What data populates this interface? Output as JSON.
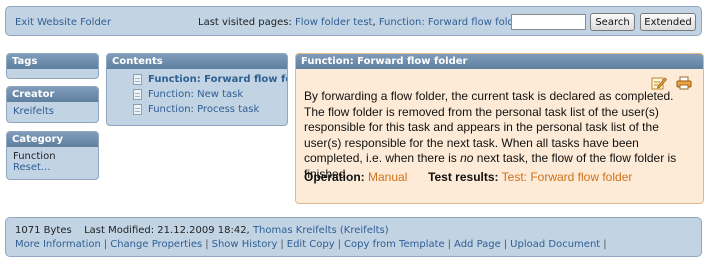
{
  "topbar": {
    "exit_link": "Exit Website Folder",
    "visited_label": "Last visited pages:",
    "visited_pages": [
      "Flow folder test",
      "Function: Forward flow folder"
    ],
    "search_placeholder": "",
    "search_button": "Search",
    "extended_button": "Extended"
  },
  "sidebar": {
    "tags_title": "Tags",
    "creator_title": "Creator",
    "creator_name": "Kreifelts",
    "category_title": "Category",
    "category_value": "Function",
    "category_reset": "Reset..."
  },
  "contents": {
    "title": "Contents",
    "items": [
      {
        "label": "Function: Forward flow folder",
        "current": true
      },
      {
        "label": "Function: New task",
        "current": false
      },
      {
        "label": "Function: Process task",
        "current": false
      }
    ]
  },
  "main": {
    "title": "Function: Forward flow folder",
    "text_before": "By forwarding a flow folder, the current task is declared as completed. The flow folder is removed from the personal task list of the user(s) responsible for this task and appears in the personal task list of the user(s) responsible for the next task. When all tasks have been completed, i.e. when there is ",
    "text_emph": "no",
    "text_after": " next task, the flow of the flow folder is finished.",
    "operation_label": "Operation:",
    "operation_value": "Manual",
    "results_label": "Test results:",
    "results_value": "Test: Forward flow folder",
    "accent_color": "#d0701a",
    "edit_icon": "edit-icon",
    "print_icon": "print-icon"
  },
  "footer": {
    "size": "1071 Bytes",
    "modified_label": "Last Modified: 21.12.2009 18:42,",
    "modified_by": "Thomas Kreifelts (Kreifelts)",
    "links": [
      "More Information",
      "Change Properties",
      "Show History",
      "Edit Copy",
      "Copy from Template",
      "Add Page",
      "Upload Document"
    ]
  }
}
